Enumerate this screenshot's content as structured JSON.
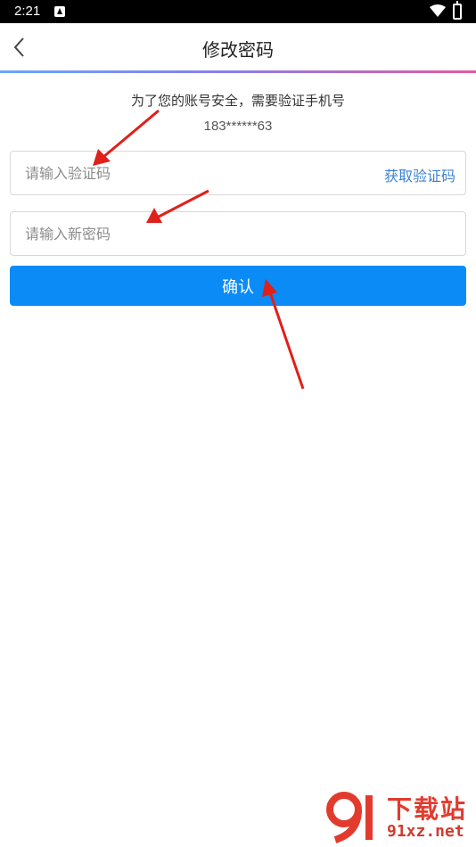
{
  "status_bar": {
    "time": "2:21"
  },
  "header": {
    "title": "修改密码"
  },
  "verify": {
    "hint": "为了您的账号安全，需要验证手机号",
    "phone_masked": "183******63"
  },
  "form": {
    "code_placeholder": "请输入验证码",
    "code_value": "",
    "get_code_label": "获取验证码",
    "password_placeholder": "请输入新密码",
    "password_value": "",
    "confirm_label": "确认"
  },
  "watermark": {
    "title": "下载站",
    "domain": "91xz.net"
  },
  "colors": {
    "primary": "#0a8bf5",
    "link": "#3b82d6",
    "gradient_start": "#6aa6f7",
    "gradient_end": "#e45a9c",
    "annotation_arrow": "#e0201a",
    "watermark": "#e23b2e"
  },
  "icons": [
    "back-arrow",
    "wifi",
    "battery",
    "app-notification"
  ]
}
